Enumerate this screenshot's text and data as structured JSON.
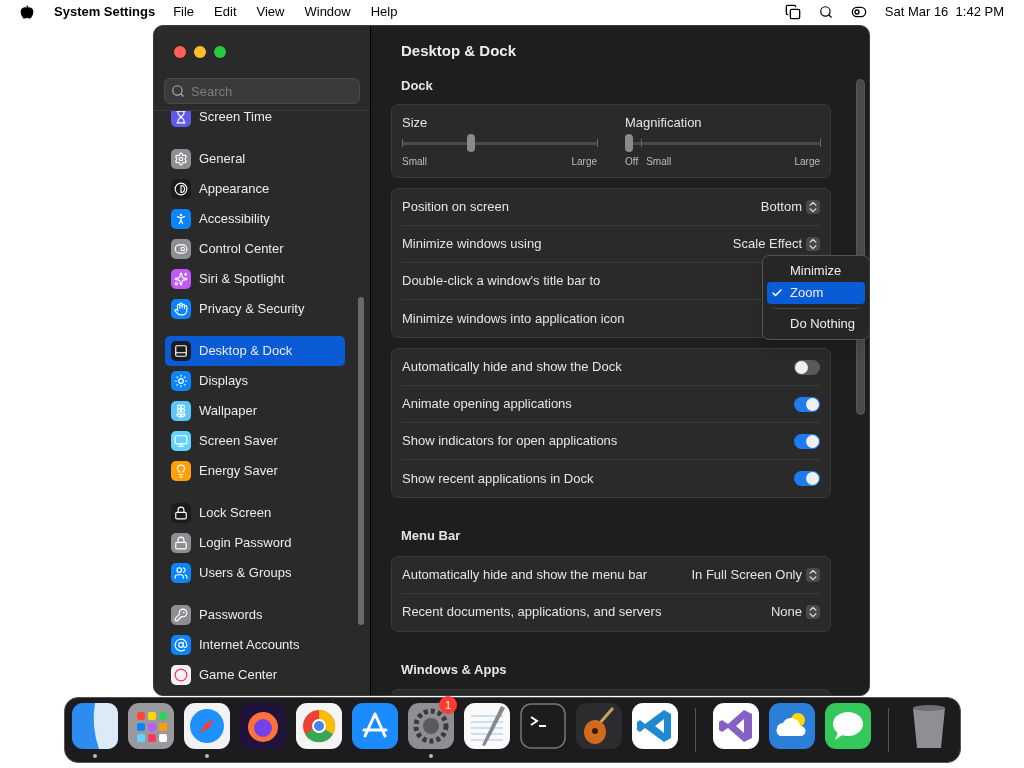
{
  "menu_bar": {
    "app": "System Settings",
    "items": [
      "File",
      "Edit",
      "View",
      "Window",
      "Help"
    ],
    "clock": "Sat Mar 16  1:42 PM"
  },
  "window": {
    "title": "Desktop & Dock"
  },
  "sidebar": {
    "search": {
      "placeholder": "Search"
    },
    "groups": [
      [
        {
          "label": "Screen Time",
          "kind": "hourglass",
          "color": "#5e5ce6",
          "selected": false
        }
      ],
      [
        {
          "label": "General",
          "kind": "gear",
          "color": "#8e8e93",
          "selected": false
        },
        {
          "label": "Appearance",
          "kind": "contrast",
          "color": "#1c1c1e",
          "selected": false
        },
        {
          "label": "Accessibility",
          "kind": "person",
          "color": "#0a84ff",
          "selected": false
        },
        {
          "label": "Control Center",
          "kind": "toggles",
          "color": "#8e8e93",
          "selected": false
        },
        {
          "label": "Siri & Spotlight",
          "kind": "sparkles",
          "color": "#bf5af2",
          "selected": false
        },
        {
          "label": "Privacy & Security",
          "kind": "hand",
          "color": "#0a84ff",
          "selected": false
        }
      ],
      [
        {
          "label": "Desktop & Dock",
          "kind": "dock",
          "color": "#1c1c1e",
          "selected": true
        },
        {
          "label": "Displays",
          "kind": "sun",
          "color": "#0a84ff",
          "selected": false
        },
        {
          "label": "Wallpaper",
          "kind": "flower",
          "color": "#5ac8fa",
          "selected": false
        },
        {
          "label": "Screen Saver",
          "kind": "monitor",
          "color": "#64d2ff",
          "selected": false
        },
        {
          "label": "Energy Saver",
          "kind": "bulb",
          "color": "#ff9f0a",
          "selected": false
        }
      ],
      [
        {
          "label": "Lock Screen",
          "kind": "lock",
          "color": "#1c1c1e",
          "selected": false
        },
        {
          "label": "Login Password",
          "kind": "lock",
          "color": "#8e8e93",
          "selected": false
        },
        {
          "label": "Users & Groups",
          "kind": "users",
          "color": "#0a84ff",
          "selected": false
        }
      ],
      [
        {
          "label": "Passwords",
          "kind": "key",
          "color": "#8e8e93",
          "selected": false
        },
        {
          "label": "Internet Accounts",
          "kind": "at",
          "color": "#0a84ff",
          "selected": false
        },
        {
          "label": "Game Center",
          "kind": "circles",
          "color": "#f2f2f7",
          "selected": false
        }
      ]
    ]
  },
  "sections": [
    {
      "heading": "Dock",
      "cards": [
        {
          "kind": "sliders",
          "sliders": [
            {
              "label": "Size",
              "level": 0.35,
              "ticks": [
                "Small",
                "Large"
              ]
            },
            {
              "label": "Magnification",
              "level": 0,
              "ticks": [
                "Off",
                "Small",
                "Large"
              ]
            }
          ]
        },
        {
          "kind": "rows",
          "rows": [
            {
              "label": "Position on screen",
              "kind": "select",
              "value": "Bottom"
            },
            {
              "label": "Minimize windows using",
              "kind": "select",
              "value": "Scale Effect"
            },
            {
              "label": "Double-click a window's title bar to",
              "kind": "plain"
            },
            {
              "label": "Minimize windows into application icon",
              "kind": "plain"
            }
          ]
        },
        {
          "kind": "rows",
          "rows": [
            {
              "label": "Automatically hide and show the Dock",
              "kind": "toggle",
              "on": false
            },
            {
              "label": "Animate opening applications",
              "kind": "toggle",
              "on": true
            },
            {
              "label": "Show indicators for open applications",
              "kind": "toggle",
              "on": true
            },
            {
              "label": "Show recent applications in Dock",
              "kind": "toggle",
              "on": true
            }
          ]
        }
      ]
    },
    {
      "heading": "Menu Bar",
      "cards": [
        {
          "kind": "rows",
          "rows": [
            {
              "label": "Automatically hide and show the menu bar",
              "kind": "select",
              "value": "In Full Screen Only"
            },
            {
              "label": "Recent documents, applications, and servers",
              "kind": "select",
              "value": "None"
            }
          ]
        }
      ]
    },
    {
      "heading": "Windows & Apps",
      "cards": [
        {
          "kind": "cut"
        }
      ]
    }
  ],
  "popup": {
    "options": [
      {
        "label": "Minimize",
        "selected": false
      },
      {
        "label": "Zoom",
        "selected": true
      },
      {
        "label": "Do Nothing",
        "selected": false,
        "divider_before": true
      }
    ]
  },
  "dock": {
    "items": [
      {
        "kind": "finder",
        "running": true
      },
      {
        "kind": "launchpad",
        "running": false
      },
      {
        "kind": "safari",
        "running": true
      },
      {
        "kind": "firefox",
        "running": false
      },
      {
        "kind": "chrome",
        "running": false
      },
      {
        "kind": "appstore",
        "running": false
      },
      {
        "kind": "settings",
        "running": true,
        "badge": "1"
      },
      {
        "kind": "textedit",
        "running": false
      },
      {
        "kind": "terminal",
        "running": false
      },
      {
        "kind": "garageband",
        "running": false
      },
      {
        "kind": "vscode",
        "running": false
      },
      {
        "kind": "separator"
      },
      {
        "kind": "visualstudio",
        "running": false
      },
      {
        "kind": "weather",
        "running": false
      },
      {
        "kind": "messages",
        "running": false
      },
      {
        "kind": "separator"
      },
      {
        "kind": "trash",
        "running": false
      }
    ]
  }
}
